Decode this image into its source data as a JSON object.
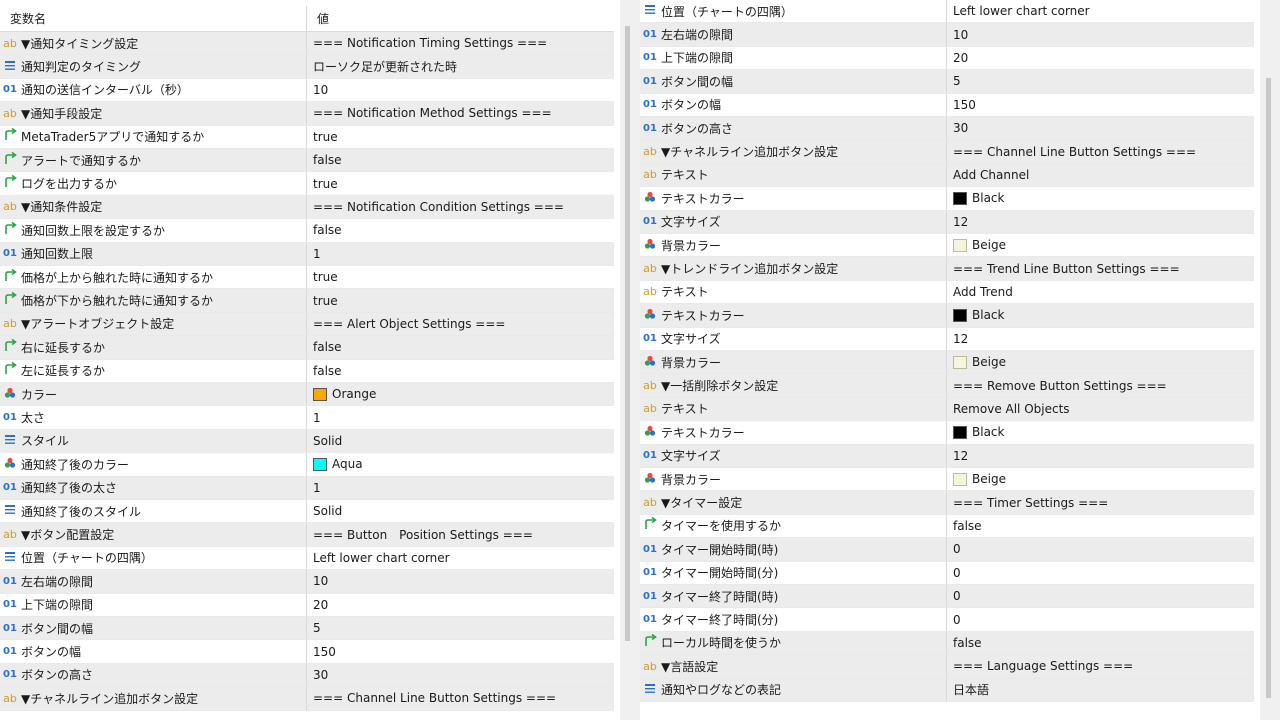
{
  "colors": {
    "orange": "#ffa500",
    "aqua": "#00ffff",
    "black": "#000000",
    "beige": "#f5f5dc"
  },
  "left": {
    "header": {
      "name_label": "変数名",
      "value_label": "値"
    },
    "rows": [
      {
        "icon": "ab",
        "name": "▼通知タイミング設定",
        "value": "=== Notification Timing Settings ===",
        "section": true
      },
      {
        "icon": "enum",
        "name": "通知判定のタイミング",
        "value": "ローソク足が更新された時"
      },
      {
        "icon": "01",
        "name": "通知の送信インターバル（秒）",
        "value": "10"
      },
      {
        "icon": "ab",
        "name": "▼通知手段設定",
        "value": "=== Notification Method Settings ===",
        "section": true
      },
      {
        "icon": "bool",
        "name": "MetaTrader5アプリで通知するか",
        "value": "true"
      },
      {
        "icon": "bool",
        "name": "アラートで通知するか",
        "value": "false"
      },
      {
        "icon": "bool",
        "name": "ログを出力するか",
        "value": "true"
      },
      {
        "icon": "ab",
        "name": "▼通知条件設定",
        "value": "=== Notification Condition Settings ===",
        "section": true
      },
      {
        "icon": "bool",
        "name": "通知回数上限を設定するか",
        "value": "false"
      },
      {
        "icon": "01",
        "name": "通知回数上限",
        "value": "1"
      },
      {
        "icon": "bool",
        "name": "価格が上から触れた時に通知するか",
        "value": "true"
      },
      {
        "icon": "bool",
        "name": "価格が下から触れた時に通知するか",
        "value": "true"
      },
      {
        "icon": "ab",
        "name": "▼アラートオブジェクト設定",
        "value": "=== Alert Object Settings ===",
        "section": true
      },
      {
        "icon": "bool",
        "name": "右に延長するか",
        "value": "false"
      },
      {
        "icon": "bool",
        "name": "左に延長するか",
        "value": "false"
      },
      {
        "icon": "color",
        "name": "カラー",
        "value": "Orange",
        "swatch": "#ffa500"
      },
      {
        "icon": "01",
        "name": "太さ",
        "value": "1"
      },
      {
        "icon": "enum",
        "name": "スタイル",
        "value": "Solid"
      },
      {
        "icon": "color",
        "name": "通知終了後のカラー",
        "value": "Aqua",
        "swatch": "#00ffff"
      },
      {
        "icon": "01",
        "name": "通知終了後の太さ",
        "value": "1"
      },
      {
        "icon": "enum",
        "name": "通知終了後のスタイル",
        "value": "Solid"
      },
      {
        "icon": "ab",
        "name": "▼ボタン配置設定",
        "value": "=== Button　Position Settings ===",
        "section": true
      },
      {
        "icon": "enum",
        "name": "位置（チャートの四隅）",
        "value": "Left lower chart corner"
      },
      {
        "icon": "01",
        "name": "左右端の隙間",
        "value": "10"
      },
      {
        "icon": "01",
        "name": "上下端の隙間",
        "value": "20"
      },
      {
        "icon": "01",
        "name": "ボタン間の幅",
        "value": "5"
      },
      {
        "icon": "01",
        "name": "ボタンの幅",
        "value": "150"
      },
      {
        "icon": "01",
        "name": "ボタンの高さ",
        "value": "30"
      },
      {
        "icon": "ab",
        "name": "▼チャネルライン追加ボタン設定",
        "value": "=== Channel Line Button Settings ===",
        "section": true
      }
    ]
  },
  "right": {
    "rows": [
      {
        "icon": "enum",
        "name": "位置（チャートの四隅）",
        "value": "Left lower chart corner"
      },
      {
        "icon": "01",
        "name": "左右端の隙間",
        "value": "10"
      },
      {
        "icon": "01",
        "name": "上下端の隙間",
        "value": "20"
      },
      {
        "icon": "01",
        "name": "ボタン間の幅",
        "value": "5"
      },
      {
        "icon": "01",
        "name": "ボタンの幅",
        "value": "150"
      },
      {
        "icon": "01",
        "name": "ボタンの高さ",
        "value": "30"
      },
      {
        "icon": "ab",
        "name": "▼チャネルライン追加ボタン設定",
        "value": "=== Channel Line Button Settings ===",
        "section": true
      },
      {
        "icon": "ab",
        "name": "テキスト",
        "value": "Add Channel"
      },
      {
        "icon": "color",
        "name": "テキストカラー",
        "value": "Black",
        "swatch": "#000000"
      },
      {
        "icon": "01",
        "name": "文字サイズ",
        "value": "12"
      },
      {
        "icon": "color",
        "name": "背景カラー",
        "value": "Beige",
        "swatch": "#f5f5dc"
      },
      {
        "icon": "ab",
        "name": "▼トレンドライン追加ボタン設定",
        "value": "=== Trend Line Button Settings ===",
        "section": true
      },
      {
        "icon": "ab",
        "name": "テキスト",
        "value": "Add Trend"
      },
      {
        "icon": "color",
        "name": "テキストカラー",
        "value": "Black",
        "swatch": "#000000"
      },
      {
        "icon": "01",
        "name": "文字サイズ",
        "value": "12"
      },
      {
        "icon": "color",
        "name": "背景カラー",
        "value": "Beige",
        "swatch": "#f5f5dc"
      },
      {
        "icon": "ab",
        "name": "▼一括削除ボタン設定",
        "value": "=== Remove Button Settings ===",
        "section": true
      },
      {
        "icon": "ab",
        "name": "テキスト",
        "value": "Remove All Objects"
      },
      {
        "icon": "color",
        "name": "テキストカラー",
        "value": "Black",
        "swatch": "#000000"
      },
      {
        "icon": "01",
        "name": "文字サイズ",
        "value": "12"
      },
      {
        "icon": "color",
        "name": "背景カラー",
        "value": "Beige",
        "swatch": "#f5f5dc"
      },
      {
        "icon": "ab",
        "name": "▼タイマー設定",
        "value": "=== Timer Settings ===",
        "section": true
      },
      {
        "icon": "bool",
        "name": "タイマーを使用するか",
        "value": "false"
      },
      {
        "icon": "01",
        "name": "タイマー開始時間(時)",
        "value": "0"
      },
      {
        "icon": "01",
        "name": "タイマー開始時間(分)",
        "value": "0"
      },
      {
        "icon": "01",
        "name": "タイマー終了時間(時)",
        "value": "0"
      },
      {
        "icon": "01",
        "name": "タイマー終了時間(分)",
        "value": "0"
      },
      {
        "icon": "bool",
        "name": "ローカル時間を使うか",
        "value": "false"
      },
      {
        "icon": "ab",
        "name": "▼言語設定",
        "value": "=== Language Settings ===",
        "section": true
      },
      {
        "icon": "enum",
        "name": "通知やログなどの表記",
        "value": "日本語"
      }
    ]
  },
  "icon_glyphs": {
    "ab": "ab",
    "01": "01",
    "enum": "☰",
    "bool": "↱",
    "color": "♣"
  },
  "icon_names": {
    "ab": "string-type-icon",
    "01": "integer-type-icon",
    "enum": "enum-type-icon",
    "bool": "boolean-type-icon",
    "color": "color-type-icon"
  }
}
